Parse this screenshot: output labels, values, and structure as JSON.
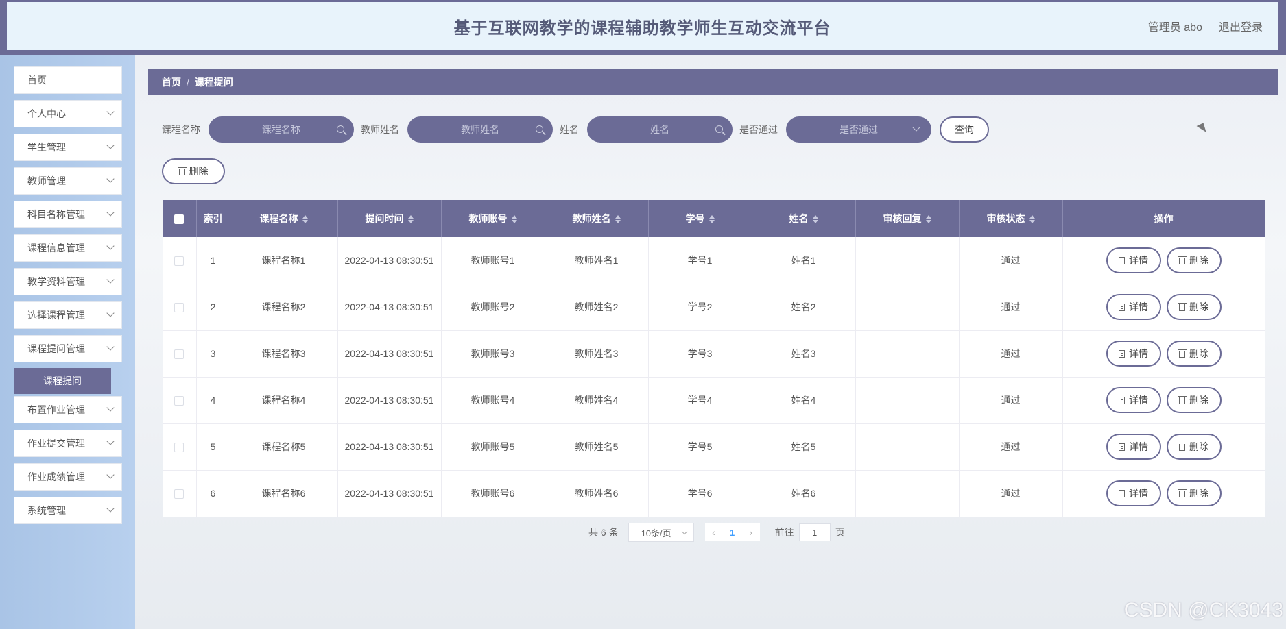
{
  "header": {
    "title": "基于互联网教学的课程辅助教学师生互动交流平台",
    "user": "管理员 abo",
    "logout": "退出登录"
  },
  "sidebar": {
    "items": [
      {
        "label": "首页",
        "chevron": false
      },
      {
        "label": "个人中心",
        "chevron": true
      },
      {
        "label": "学生管理",
        "chevron": true
      },
      {
        "label": "教师管理",
        "chevron": true
      },
      {
        "label": "科目名称管理",
        "chevron": true
      },
      {
        "label": "课程信息管理",
        "chevron": true
      },
      {
        "label": "教学资料管理",
        "chevron": true
      },
      {
        "label": "选择课程管理",
        "chevron": true
      },
      {
        "label": "课程提问管理",
        "chevron": true
      },
      {
        "label": "布置作业管理",
        "chevron": true
      },
      {
        "label": "作业提交管理",
        "chevron": true
      },
      {
        "label": "作业成绩管理",
        "chevron": true
      },
      {
        "label": "系统管理",
        "chevron": true
      }
    ],
    "active_sub": "课程提问"
  },
  "breadcrumb": {
    "home": "首页",
    "sep": "/",
    "current": "课程提问"
  },
  "search": {
    "course_label": "课程名称",
    "course_placeholder": "课程名称",
    "teacher_label": "教师姓名",
    "teacher_placeholder": "教师姓名",
    "name_label": "姓名",
    "name_placeholder": "姓名",
    "pass_label": "是否通过",
    "pass_placeholder": "是否通过",
    "query_button": "查询"
  },
  "actions": {
    "bulk_delete": "删除"
  },
  "table": {
    "headers": [
      "索引",
      "课程名称",
      "提问时间",
      "教师账号",
      "教师姓名",
      "学号",
      "姓名",
      "审核回复",
      "审核状态",
      "操作"
    ],
    "detail_label": "详情",
    "delete_label": "删除",
    "rows": [
      {
        "index": "1",
        "course": "课程名称1",
        "time": "2022-04-13 08:30:51",
        "teacher_account": "教师账号1",
        "teacher_name": "教师姓名1",
        "student_no": "学号1",
        "name": "姓名1",
        "reply": "",
        "status": "通过"
      },
      {
        "index": "2",
        "course": "课程名称2",
        "time": "2022-04-13 08:30:51",
        "teacher_account": "教师账号2",
        "teacher_name": "教师姓名2",
        "student_no": "学号2",
        "name": "姓名2",
        "reply": "",
        "status": "通过"
      },
      {
        "index": "3",
        "course": "课程名称3",
        "time": "2022-04-13 08:30:51",
        "teacher_account": "教师账号3",
        "teacher_name": "教师姓名3",
        "student_no": "学号3",
        "name": "姓名3",
        "reply": "",
        "status": "通过"
      },
      {
        "index": "4",
        "course": "课程名称4",
        "time": "2022-04-13 08:30:51",
        "teacher_account": "教师账号4",
        "teacher_name": "教师姓名4",
        "student_no": "学号4",
        "name": "姓名4",
        "reply": "",
        "status": "通过"
      },
      {
        "index": "5",
        "course": "课程名称5",
        "time": "2022-04-13 08:30:51",
        "teacher_account": "教师账号5",
        "teacher_name": "教师姓名5",
        "student_no": "学号5",
        "name": "姓名5",
        "reply": "",
        "status": "通过"
      },
      {
        "index": "6",
        "course": "课程名称6",
        "time": "2022-04-13 08:30:51",
        "teacher_account": "教师账号6",
        "teacher_name": "教师姓名6",
        "student_no": "学号6",
        "name": "姓名6",
        "reply": "",
        "status": "通过"
      }
    ]
  },
  "pagination": {
    "total": "共 6 条",
    "page_size": "10条/页",
    "prev": "‹",
    "current": "1",
    "next": "›",
    "goto_label": "前往",
    "goto_value": "1",
    "page_suffix": "页"
  },
  "watermark": "CSDN @CK3043",
  "colors": {
    "primary": "#6b6b96",
    "header_bg": "#e8f3fb",
    "sidebar_bg": "#b8d0ee",
    "link": "#409eff"
  }
}
